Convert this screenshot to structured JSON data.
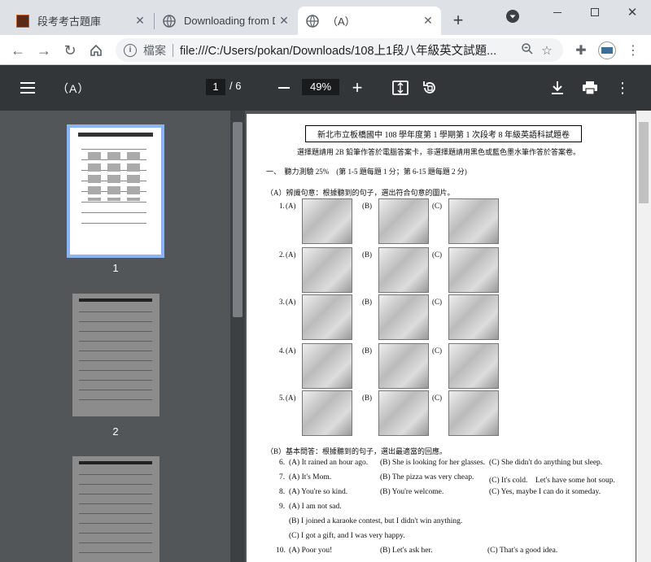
{
  "tabs": [
    {
      "label": "段考考古題庫",
      "icon": "site-logo-icon"
    },
    {
      "label": "Downloading from Drive",
      "icon": "globe-icon"
    },
    {
      "label": "（A）",
      "icon": "globe-icon"
    }
  ],
  "address": {
    "secure_label": "檔案",
    "url": "file:///C:/Users/pokan/Downloads/108上1段八年級英文試題..."
  },
  "pdf": {
    "title": "（A）",
    "current_page": "1",
    "total_pages": "6",
    "zoom": "49%"
  },
  "thumbnails": [
    "1",
    "2"
  ],
  "document": {
    "title": "新北市立板橋國中 108 學年度第 1 學期第 1 次段考 8 年級英語科試題卷",
    "instructions": "選擇題請用 2B 鉛筆作答於電腦答案卡，非選擇題請用黑色或藍色墨水筆作答於答案卷。",
    "section1": "一、　聽力測驗 25%　(第 1-5 題每題 1 分；第 6-15 題每題 2 分)",
    "partA": "（A）辨識句意：根據聽到的句子，選出符合句意的圖片。",
    "partB": "（B）基本問答：根據聽到的句子，選出最適當的回應。",
    "pic_questions": [
      "1.",
      "2.",
      "3.",
      "4.",
      "5."
    ],
    "option_labels": [
      "(A)",
      "(B)",
      "(C)"
    ],
    "q6": [
      "6.",
      "(A) It rained an hour ago.",
      "(B) She is looking for her glasses.",
      "(C) She didn't do anything but sleep."
    ],
    "q7": [
      "7.",
      "(A) It's Mom.",
      "(B) The pizza was very cheap.",
      "(C) It's cold.　Let's have some hot soup."
    ],
    "q8": [
      "8.",
      "(A) You're so kind.",
      "(B) You're welcome.",
      "(C) Yes, maybe I can do it someday."
    ],
    "q9": [
      "9.",
      "(A) I am not sad.",
      "(B) I joined a karaoke contest, but I didn't win anything.",
      "(C) I got a gift, and I was very happy."
    ],
    "q10": [
      "10.",
      "(A) Poor you!",
      "(B) Let's ask her.",
      "(C) That's a good idea."
    ]
  }
}
